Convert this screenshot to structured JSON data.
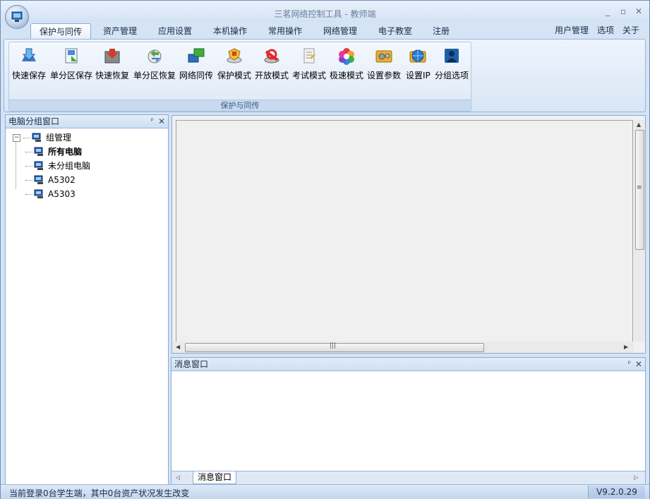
{
  "window": {
    "title": "三茗网络控制工具 - 教师端",
    "minimize_label": "_",
    "maximize_label": "▫",
    "close_label": "✕"
  },
  "tabs": [
    {
      "label": "保护与同传",
      "active": true
    },
    {
      "label": "资产管理"
    },
    {
      "label": "应用设置"
    },
    {
      "label": "本机操作"
    },
    {
      "label": "常用操作"
    },
    {
      "label": "网络管理"
    },
    {
      "label": "电子教室"
    },
    {
      "label": "注册"
    }
  ],
  "right_menu": {
    "user_mgmt": "用户管理",
    "options": "选项",
    "about": "关于"
  },
  "ribbon": {
    "group_label": "保护与同传",
    "buttons": [
      {
        "label": "快速保存",
        "icon": "quick-save-icon"
      },
      {
        "label": "单分区保存",
        "icon": "partition-save-icon"
      },
      {
        "label": "快速恢复",
        "icon": "quick-restore-icon"
      },
      {
        "label": "单分区恢复",
        "icon": "partition-restore-icon"
      },
      {
        "label": "网络同传",
        "icon": "network-transfer-icon"
      },
      {
        "label": "保护模式",
        "icon": "protect-mode-icon"
      },
      {
        "label": "开放模式",
        "icon": "open-mode-icon"
      },
      {
        "label": "考试模式",
        "icon": "exam-mode-icon"
      },
      {
        "label": "极速模式",
        "icon": "turbo-mode-icon"
      },
      {
        "label": "设置参数",
        "icon": "settings-icon"
      },
      {
        "label": "设置IP",
        "icon": "set-ip-icon"
      },
      {
        "label": "分组选项",
        "icon": "group-options-icon"
      }
    ]
  },
  "left_panel": {
    "title": "电脑分组窗口",
    "pin": "ᵖ",
    "close": "✕",
    "root": "组管理",
    "root_expander": "−",
    "children": [
      "所有电脑",
      "未分组电脑",
      "A5302",
      "A5303"
    ]
  },
  "message_panel": {
    "title": "消息窗口",
    "pin": "ᵖ",
    "close": "✕",
    "tab_label": "消息窗口"
  },
  "scroll": {
    "grip": "|||",
    "menu": "≡"
  },
  "status": {
    "text": "当前登录0台学生端，其中0台资产状况发生改变",
    "version": "V9.2.0.29"
  },
  "colors": {
    "accent": "#d4e3f5",
    "border": "#8eabd2"
  }
}
